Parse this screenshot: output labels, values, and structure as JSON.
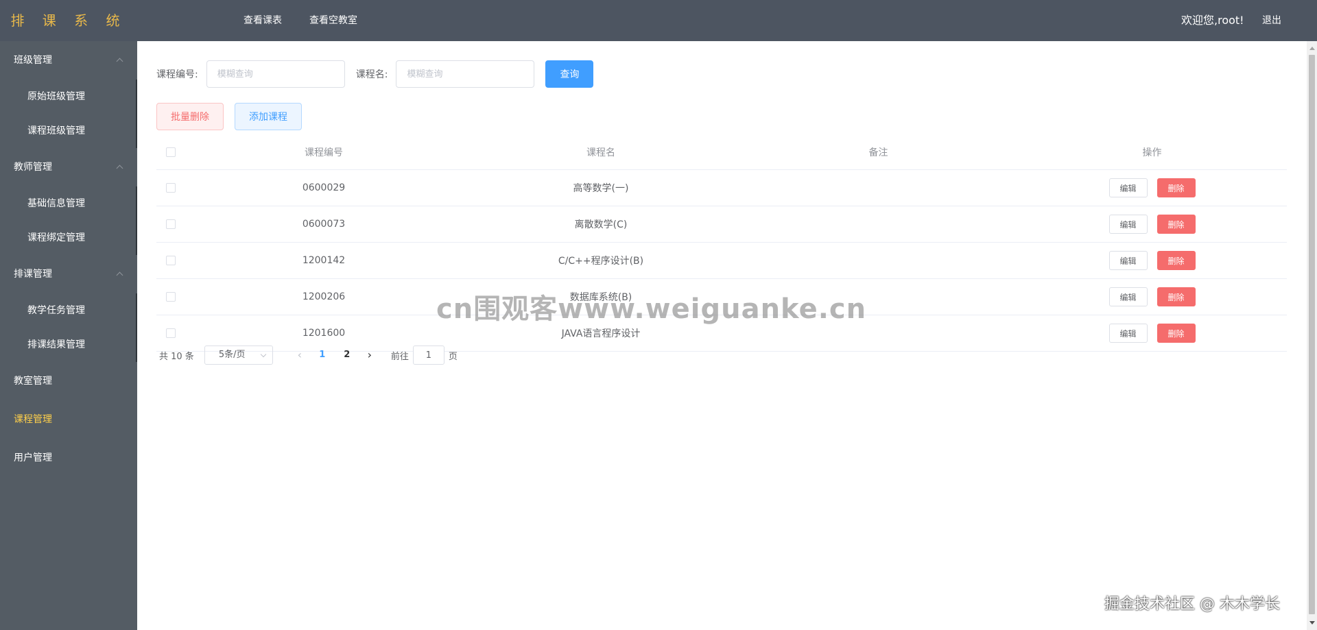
{
  "app": {
    "title": "排 课 系 统"
  },
  "topnav": {
    "items": [
      "查看课表",
      "查看空教室"
    ]
  },
  "user": {
    "welcome": "欢迎您,root!",
    "logout": "退出"
  },
  "sidebar": {
    "groups": [
      {
        "label": "班级管理",
        "expanded": true,
        "children": [
          "原始班级管理",
          "课程班级管理"
        ]
      },
      {
        "label": "教师管理",
        "expanded": true,
        "children": [
          "基础信息管理",
          "课程绑定管理"
        ]
      },
      {
        "label": "排课管理",
        "expanded": true,
        "children": [
          "教学任务管理",
          "排课结果管理"
        ]
      },
      {
        "label": "教室管理"
      },
      {
        "label": "课程管理",
        "active": true
      },
      {
        "label": "用户管理"
      }
    ]
  },
  "search": {
    "code_label": "课程编号:",
    "code_placeholder": "模糊查询",
    "name_label": "课程名:",
    "name_placeholder": "模糊查询",
    "query_button": "查询"
  },
  "actions": {
    "batch_delete": "批量删除",
    "add_course": "添加课程"
  },
  "table": {
    "headers": {
      "code": "课程编号",
      "name": "课程名",
      "note": "备注",
      "ops": "操作"
    },
    "rows": [
      {
        "code": "0600029",
        "name": "高等数学(一)",
        "note": ""
      },
      {
        "code": "0600073",
        "name": "离散数学(C)",
        "note": ""
      },
      {
        "code": "1200142",
        "name": "C/C++程序设计(B)",
        "note": ""
      },
      {
        "code": "1200206",
        "name": "数据库系统(B)",
        "note": ""
      },
      {
        "code": "1201600",
        "name": "JAVA语言程序设计",
        "note": ""
      }
    ],
    "edit_label": "编辑",
    "delete_label": "删除"
  },
  "pagination": {
    "total": "共 10 条",
    "page_size": "5条/页",
    "pages": [
      "1",
      "2"
    ],
    "current_page": "1",
    "goto_label": "前往",
    "goto_value": "1",
    "page_suffix": "页"
  },
  "watermarks": {
    "center": "cn围观客www.weiguanke.cn",
    "corner": "掘金技术社区 @ 木木学长"
  },
  "colors": {
    "header_bg": "#4d5561",
    "sidebar_bg": "#545c64",
    "logo": "#e8b84a",
    "active_menu": "#ffd04b",
    "primary": "#409eff",
    "danger": "#f56c6c"
  }
}
